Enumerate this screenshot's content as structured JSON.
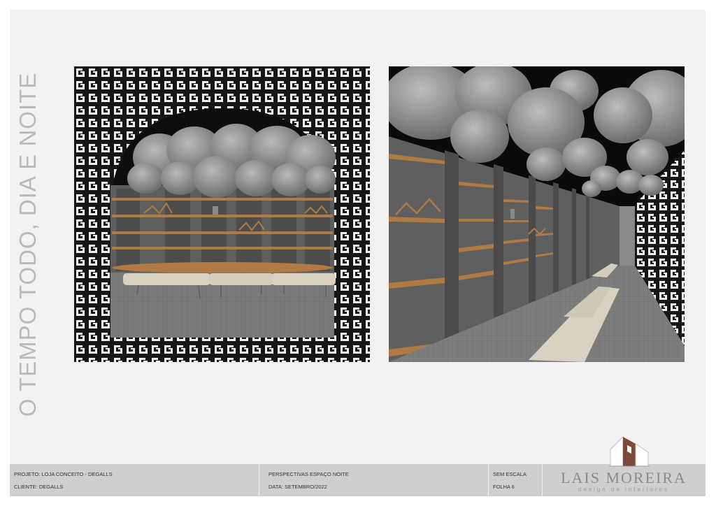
{
  "vertical_title": "O TEMPO TODO, DIA E NOITE",
  "footer": {
    "project": "PROJETO: LOJA CONCEITO - DEGALLS",
    "client": "CLIENTE: DEGALLS",
    "sheet_title": "PERSPECTIVAS ESPAÇO NOITE",
    "date": "DATA: SETEMBRO/2022",
    "scale": "SEM ESCALA",
    "sheet_number": "FOLHA 6"
  },
  "logo": {
    "name": "LAIS MOREIRA",
    "subtitle": "design de interiores"
  },
  "colors": {
    "sheet": "#f3f2f1",
    "footer": "#cfcfcf",
    "wood": "#b07a42",
    "wall_gray": "#6a6a6a",
    "sphere": "#8c8c8c",
    "bench": "#d9d2c3",
    "logo_brown": "#7b4a3a"
  }
}
